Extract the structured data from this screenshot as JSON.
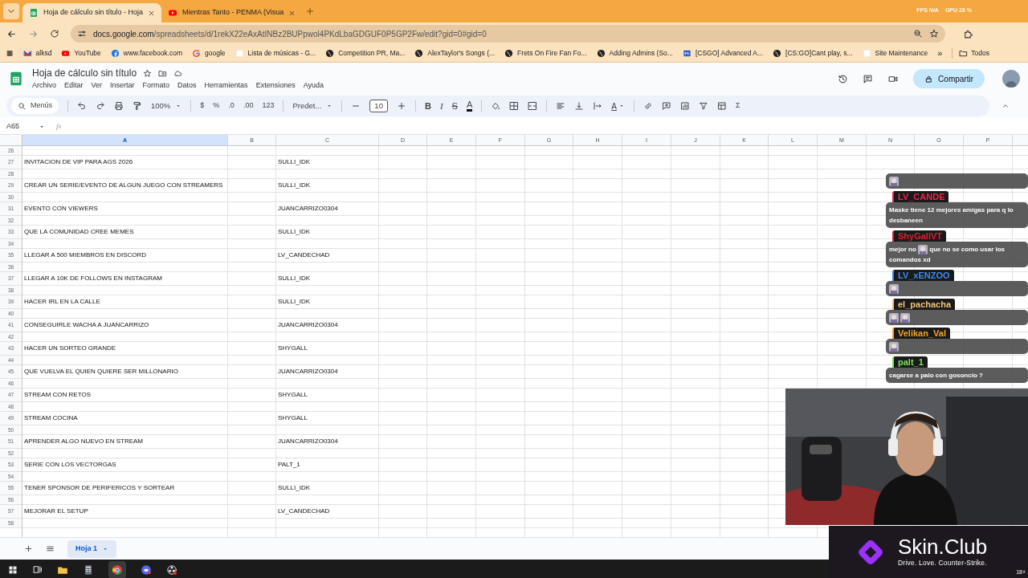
{
  "browser": {
    "tabs": [
      {
        "title": "Hoja de cálculo sin título - Hoja",
        "kind": "sheets",
        "selected": true
      },
      {
        "title": "Mientras Tanto - PENMA (Visua",
        "kind": "youtube",
        "selected": false
      }
    ],
    "stats": [
      "FPS N/A",
      "GPU 28 %"
    ],
    "url_host": "docs.google.com",
    "url_path": "/spreadsheets/d/1rekX22eAxAtINBz2BUPpwol4PKdLbaGDGUF0P5GP2Fw/edit?gid=0#gid=0",
    "bookmarks": [
      {
        "label": "alksd",
        "kind": "mail"
      },
      {
        "label": "YouTube",
        "kind": "youtube"
      },
      {
        "label": "www.facebook.com",
        "kind": "facebook"
      },
      {
        "label": "google",
        "kind": "google"
      },
      {
        "label": "Lista de músicas - G...",
        "kind": "blank"
      },
      {
        "label": "Competition PR, Ma...",
        "kind": "globe"
      },
      {
        "label": "AlexTaylor's Songs (...",
        "kind": "globe"
      },
      {
        "label": "Frets On Fire Fan Fo...",
        "kind": "globe"
      },
      {
        "label": "Adding Admins (So...",
        "kind": "globe"
      },
      {
        "label": "[CSGO] Advanced A...",
        "kind": "flag"
      },
      {
        "label": "[CS:GO]Cant play, s...",
        "kind": "globe"
      },
      {
        "label": "Site Maintenance",
        "kind": "blank"
      }
    ],
    "more_bookmarks": "»",
    "all_bookmarks": "Todos"
  },
  "sheet": {
    "title": "Hoja de cálculo sin título",
    "menus": [
      "Archivo",
      "Editar",
      "Ver",
      "Insertar",
      "Formato",
      "Datos",
      "Herramientas",
      "Extensiones",
      "Ayuda"
    ],
    "share": "Compartir",
    "toolbar": [
      {
        "kind": "search",
        "label": "Menús"
      },
      {
        "kind": "sep"
      },
      {
        "kind": "undo"
      },
      {
        "kind": "redo"
      },
      {
        "kind": "print"
      },
      {
        "kind": "paintformat"
      },
      {
        "kind": "dropdown",
        "label": "100%"
      },
      {
        "kind": "sep"
      },
      {
        "kind": "text",
        "label": "$"
      },
      {
        "kind": "text",
        "label": "%"
      },
      {
        "kind": "text",
        "label": ".0"
      },
      {
        "kind": "text",
        "label": ".00"
      },
      {
        "kind": "text",
        "label": "123"
      },
      {
        "kind": "sep"
      },
      {
        "kind": "dropdown",
        "label": "Predet..."
      },
      {
        "kind": "sep"
      },
      {
        "kind": "minus"
      },
      {
        "kind": "size",
        "label": "10"
      },
      {
        "kind": "plus"
      },
      {
        "kind": "sep"
      },
      {
        "kind": "bold",
        "label": "B"
      },
      {
        "kind": "italic",
        "label": "I"
      },
      {
        "kind": "strike",
        "label": "S"
      },
      {
        "kind": "textcolor",
        "label": "A"
      },
      {
        "kind": "sep"
      },
      {
        "kind": "fill"
      },
      {
        "kind": "borders"
      },
      {
        "kind": "merge"
      },
      {
        "kind": "sep"
      },
      {
        "kind": "align"
      },
      {
        "kind": "valign"
      },
      {
        "kind": "wrap"
      },
      {
        "kind": "rotate",
        "label": "A"
      },
      {
        "kind": "sep"
      },
      {
        "kind": "link"
      },
      {
        "kind": "comment"
      },
      {
        "kind": "chart"
      },
      {
        "kind": "filter"
      },
      {
        "kind": "view"
      },
      {
        "kind": "text",
        "label": "Σ"
      }
    ],
    "name_box": "A65",
    "fx": "fx",
    "columns": [
      {
        "label": "A",
        "selected": true
      },
      {
        "label": "B",
        "selected": false
      },
      {
        "label": "C",
        "selected": false
      },
      {
        "label": "D",
        "selected": false
      },
      {
        "label": "E",
        "selected": false
      },
      {
        "label": "F",
        "selected": false
      },
      {
        "label": "G",
        "selected": false
      },
      {
        "label": "H",
        "selected": false
      },
      {
        "label": "I",
        "selected": false
      },
      {
        "label": "J",
        "selected": false
      },
      {
        "label": "K",
        "selected": false
      },
      {
        "label": "L",
        "selected": false
      },
      {
        "label": "M",
        "selected": false
      },
      {
        "label": "N",
        "selected": false
      },
      {
        "label": "O",
        "selected": false
      },
      {
        "label": "P",
        "selected": false
      }
    ],
    "rows": [
      {
        "number": "26"
      },
      {
        "number": "27",
        "col_a": "INVITACION DE VIP PARA AGS 2026",
        "col_c": "SULLI_IDK"
      },
      {
        "number": "28"
      },
      {
        "number": "29",
        "col_a": "CREAR UN SERIE/EVENTO DE ALGUN JUEGO CON STREAMERS",
        "col_c": "SULLI_IDK"
      },
      {
        "number": "30"
      },
      {
        "number": "31",
        "col_a": "EVENTO CON VIEWERS",
        "col_c": "JUANCARRIZO0304"
      },
      {
        "number": "32"
      },
      {
        "number": "33",
        "col_a": "QUE LA COMUNIDAD CREE MEMES",
        "col_c": "SULLI_IDK"
      },
      {
        "number": "34"
      },
      {
        "number": "35",
        "col_a": "LLEGAR A 500 MIEMBROS EN DISCORD",
        "col_c": "LV_CANDECHAD"
      },
      {
        "number": "36"
      },
      {
        "number": "37",
        "col_a": "LLEGAR A 10K DE FOLLOWS EN INSTAGRAM",
        "col_c": "SULLI_IDK"
      },
      {
        "number": "38"
      },
      {
        "number": "39",
        "col_a": "HACER IRL EN LA CALLE",
        "col_c": "SULLI_IDK"
      },
      {
        "number": "40"
      },
      {
        "number": "41",
        "col_a": "CONSEGUIRLE WACHA A JUANCARRIZO",
        "col_c": "JUANCARRIZO0304"
      },
      {
        "number": "42"
      },
      {
        "number": "43",
        "col_a": "HACER UN SORTEO GRANDE",
        "col_c": "SHYGALL"
      },
      {
        "number": "44"
      },
      {
        "number": "45",
        "col_a": "QUE VUELVA EL QUIEN QUIERE SER MILLONARIO",
        "col_c": "JUANCARRIZO0304"
      },
      {
        "number": "46"
      },
      {
        "number": "47",
        "col_a": "STREAM CON RETOS",
        "col_c": "SHYGALL"
      },
      {
        "number": "48"
      },
      {
        "number": "49",
        "col_a": "STREAM COCINA",
        "col_c": "SHYGALL"
      },
      {
        "number": "50"
      },
      {
        "number": "51",
        "col_a": "APRENDER ALGO NUEVO EN STREAM",
        "col_c": "JUANCARRIZO0304"
      },
      {
        "number": "52"
      },
      {
        "number": "53",
        "col_a": "SERIE CON LOS VECTORGAS",
        "col_c": "PALT_1"
      },
      {
        "number": "54"
      },
      {
        "number": "55",
        "col_a": "TENER SPONSOR DE PERIFERICOS Y SORTEAR",
        "col_c": "SULLI_IDK"
      },
      {
        "number": "56"
      },
      {
        "number": "57",
        "col_a": "MEJORAR EL SETUP",
        "col_c": "LV_CANDECHAD"
      },
      {
        "number": "58"
      }
    ],
    "sheet_tabs": [
      {
        "label": "Hoja 1",
        "selected": true
      }
    ]
  },
  "chat": [
    {
      "parts": [
        {
          "kind": "emote"
        }
      ]
    },
    {
      "user": "LV_CANDE",
      "color": "#e8284f",
      "parts": [
        {
          "kind": "text",
          "text": "Maske tiene 12 mejores amigas para q lo desbaneen"
        }
      ]
    },
    {
      "user": "ShyGallVT",
      "color": "#d9232f",
      "parts": [
        {
          "kind": "text",
          "text": "mejor no"
        },
        {
          "kind": "emote"
        },
        {
          "kind": "text",
          "text": "que no se como usar los comandos xd"
        }
      ]
    },
    {
      "user": "LV_xENZOO",
      "color": "#3d8bf0",
      "parts": [
        {
          "kind": "emote"
        }
      ]
    },
    {
      "user": "el_pachacha",
      "color": "#f2c27a",
      "parts": [
        {
          "kind": "emote"
        },
        {
          "kind": "emote"
        }
      ]
    },
    {
      "user": "Velikan_Val",
      "color": "#f5a623",
      "parts": [
        {
          "kind": "emote"
        }
      ]
    },
    {
      "user": "palt_1",
      "color": "#7ee35f",
      "parts": [
        {
          "kind": "text",
          "text": "cagarse a palo con gosoncio ?"
        }
      ]
    }
  ],
  "ad": {
    "brand": "Skin.Club",
    "slogan": "Drive. Love. Counter-Strike.",
    "age": "18+"
  }
}
